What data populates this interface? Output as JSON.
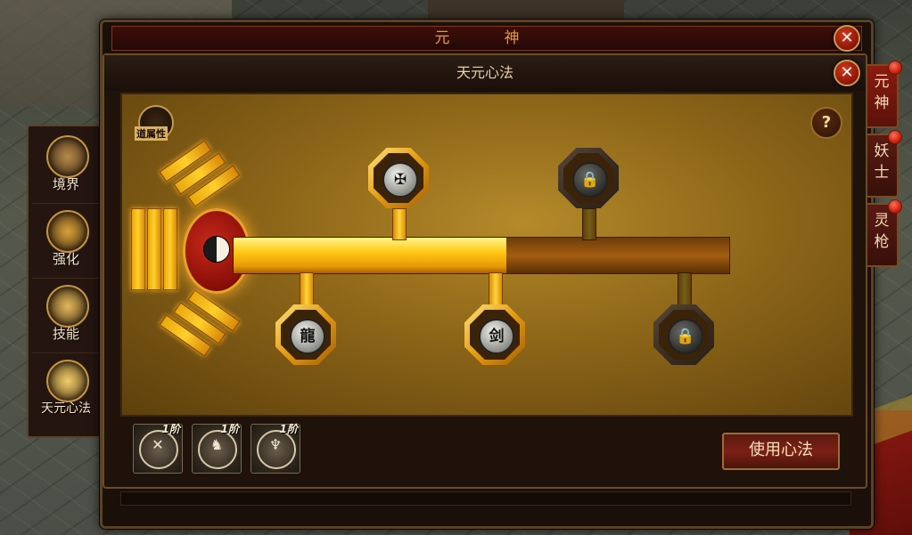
{
  "outer_window": {
    "title": "元　神"
  },
  "inner_window": {
    "title": "天元心法"
  },
  "left_nav": [
    {
      "label": "境界",
      "icon": "figure-icon"
    },
    {
      "label": "强化",
      "icon": "forge-icon"
    },
    {
      "label": "技能",
      "icon": "scroll-icon"
    },
    {
      "label": "天元心法",
      "icon": "book-icon",
      "active": true
    }
  ],
  "right_tabs": [
    {
      "label": "元神",
      "active": true
    },
    {
      "label": "妖士"
    },
    {
      "label": "灵枪"
    }
  ],
  "dao_badge": {
    "label": "道属性"
  },
  "help_label": "?",
  "progress_fraction": 0.55,
  "nodes": [
    {
      "glyph": "✠",
      "locked": false,
      "row": "top"
    },
    {
      "glyph": "🔒",
      "locked": true,
      "row": "top"
    },
    {
      "glyph": "龍",
      "locked": false,
      "row": "bottom"
    },
    {
      "glyph": "剑",
      "locked": false,
      "row": "bottom"
    },
    {
      "glyph": "🔒",
      "locked": true,
      "row": "bottom"
    }
  ],
  "skills": [
    {
      "level": "1阶",
      "glyph": "✕"
    },
    {
      "level": "1阶",
      "glyph": "♞"
    },
    {
      "level": "1阶",
      "glyph": "♆"
    }
  ],
  "use_button": "使用心法",
  "colors": {
    "accent_gold": "#ffc814",
    "frame_brown": "#5b4226",
    "button_red": "#7c2014"
  }
}
